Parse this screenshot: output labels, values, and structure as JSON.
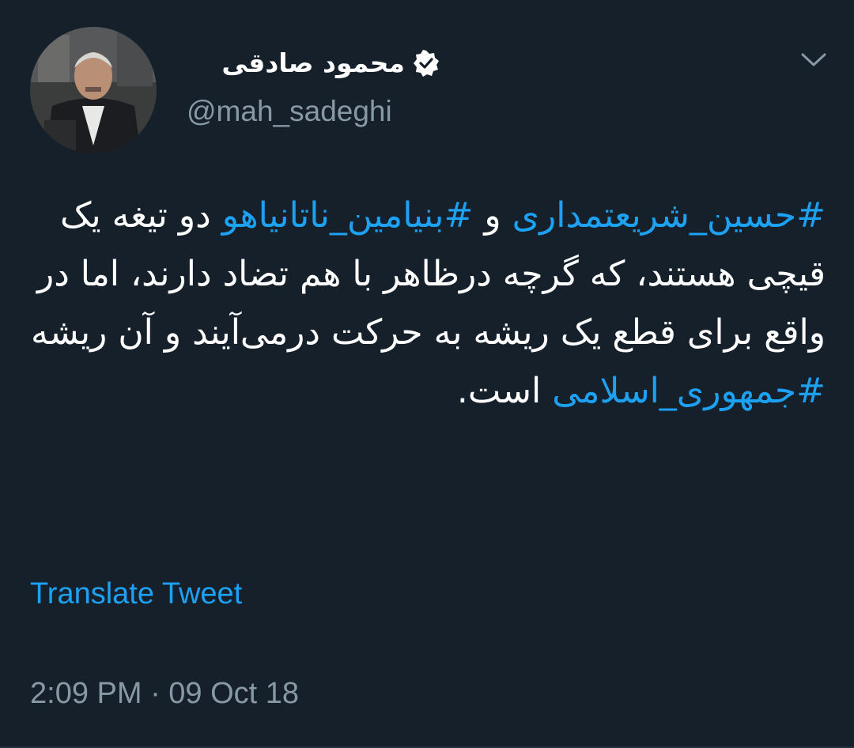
{
  "user": {
    "display_name": "محمود صادقی",
    "handle": "@mah_sadeghi",
    "verified": true
  },
  "tweet": {
    "hashtag_1": "#حسین_شریعتمداری",
    "connector": " و ",
    "hashtag_2": "#بنیامین_ناتانیاهو",
    "text_1": " دو تیغه یک قیچی هستند، که گرچه درظاهر با هم تضاد دارند، اما در واقع برای قطع یک ریشه به حرکت درمی‌آیند و آن ریشه ",
    "hashtag_3": "#جمهوری_اسلامی",
    "text_2": " است."
  },
  "translate_label": "Translate Tweet",
  "timestamp": "2:09 PM · 09 Oct 18",
  "colors": {
    "background": "#15202b",
    "link": "#1da1f2",
    "muted": "#8899a6",
    "text": "#ffffff"
  },
  "icons": {
    "verified": "verified-badge-icon",
    "caret": "chevron-down-icon"
  }
}
